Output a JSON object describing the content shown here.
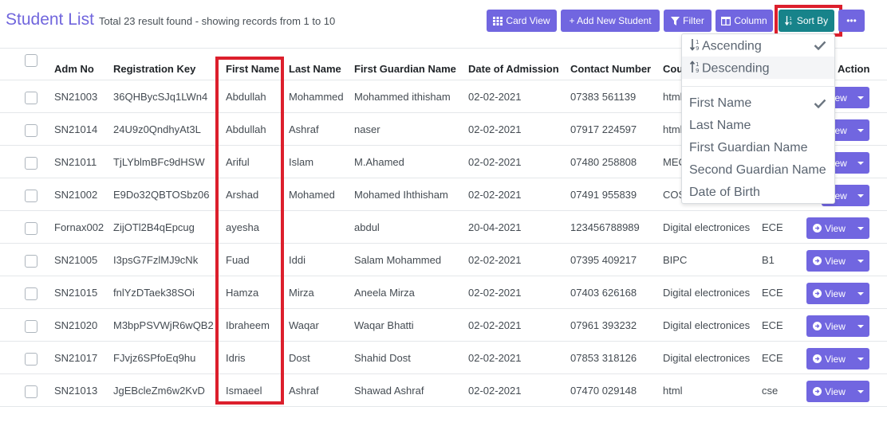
{
  "header": {
    "title": "Student List",
    "result_text": "Total 23 result found - showing records from 1 to 10"
  },
  "toolbar": {
    "card_view": "Card View",
    "add_new": "+ Add New Student",
    "filter": "Filter",
    "column": "Column",
    "sort_by": "Sort By",
    "more": "•••"
  },
  "colors": {
    "accent": "#7166e0",
    "sort_active": "#17838a",
    "highlight": "#dc1f2c"
  },
  "table": {
    "columns": {
      "adm_no": "Adm No",
      "reg_key": "Registration Key",
      "first_name": "First Name",
      "last_name": "Last Name",
      "guardian": "First Guardian Name",
      "doa": "Date of Admission",
      "contact": "Contact Number",
      "course": "Cou",
      "action": "Action"
    },
    "view_label": "View",
    "rows": [
      {
        "adm": "SN21003",
        "reg": "36QHBycSJq1LWn4",
        "first": "Abdullah",
        "last": "Mohammed",
        "guardian": "Mohammed ithisham",
        "doa": "02-02-2021",
        "contact": "07383 561139",
        "course": "html",
        "class": ""
      },
      {
        "adm": "SN21014",
        "reg": "24U9z0QndhyAt3L",
        "first": "Abdullah",
        "last": "Ashraf",
        "guardian": "naser",
        "doa": "02-02-2021",
        "contact": "07917 224597",
        "course": "html",
        "class": ""
      },
      {
        "adm": "SN21011",
        "reg": "TjLYblmBFc9dHSW",
        "first": "Ariful",
        "last": "Islam",
        "guardian": "M.Ahamed",
        "doa": "02-02-2021",
        "contact": "07480 258808",
        "course": "MEC",
        "class": ""
      },
      {
        "adm": "SN21002",
        "reg": "E9Do32QBTOSbz06",
        "first": "Arshad",
        "last": "Mohamed",
        "guardian": "Mohamed Ihthisham",
        "doa": "02-02-2021",
        "contact": "07491 955839",
        "course": "COS",
        "class": ""
      },
      {
        "adm": "Fornax002",
        "reg": "ZijOTl2B4qEpcug",
        "first": "ayesha",
        "last": "",
        "guardian": "abdul",
        "doa": "20-04-2021",
        "contact": "123456788989",
        "course": "Digital electronices",
        "class": "ECE"
      },
      {
        "adm": "SN21005",
        "reg": "I3psG7FzlMJ9cNk",
        "first": "Fuad",
        "last": "Iddi",
        "guardian": "Salam Mohammed",
        "doa": "02-02-2021",
        "contact": "07395 409217",
        "course": "BIPC",
        "class": "B1"
      },
      {
        "adm": "SN21015",
        "reg": "fnlYzDTaek38SOi",
        "first": "Hamza",
        "last": "Mirza",
        "guardian": "Aneela Mirza",
        "doa": "02-02-2021",
        "contact": "07403 626168",
        "course": "Digital electronices",
        "class": "ECE"
      },
      {
        "adm": "SN21020",
        "reg": "M3bpPSVWjR6wQB2",
        "first": "Ibraheem",
        "last": "Waqar",
        "guardian": "Waqar Bhatti",
        "doa": "02-02-2021",
        "contact": "07961 393232",
        "course": "Digital electronices",
        "class": "ECE"
      },
      {
        "adm": "SN21017",
        "reg": "FJvjz6SPfoEq9hu",
        "first": "Idris",
        "last": "Dost",
        "guardian": "Shahid Dost",
        "doa": "02-02-2021",
        "contact": "07853 318126",
        "course": "Digital electronices",
        "class": "ECE"
      },
      {
        "adm": "SN21013",
        "reg": "JgEBcleZm6w2KvD",
        "first": "Ismaeel",
        "last": "Ashraf",
        "guardian": "Shawad Ashraf",
        "doa": "02-02-2021",
        "contact": "07470 029148",
        "course": "html",
        "class": "cse"
      }
    ]
  },
  "sort_menu": {
    "order_items": [
      {
        "label": "Ascending",
        "icon": "sort-ascending-icon",
        "checked": true
      },
      {
        "label": "Descending",
        "icon": "sort-descending-icon",
        "checked": false
      }
    ],
    "field_items": [
      {
        "label": "First Name",
        "checked": true
      },
      {
        "label": "Last Name",
        "checked": false
      },
      {
        "label": "First Guardian Name",
        "checked": false
      },
      {
        "label": "Second Guardian Name",
        "checked": false
      },
      {
        "label": "Date of Birth",
        "checked": false
      }
    ]
  }
}
